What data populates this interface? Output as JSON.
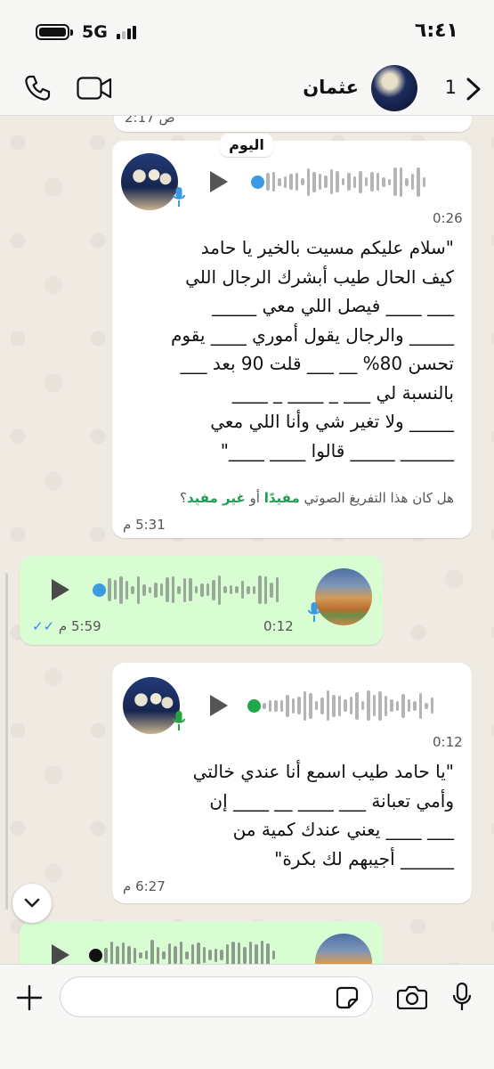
{
  "status_bar": {
    "time": "٦:٤١",
    "network": "5G"
  },
  "header": {
    "contact_name": "عثمان",
    "unread_count": "1"
  },
  "chat": {
    "previous_time": "2:17 ص",
    "date_chip": "اليوم",
    "messages": [
      {
        "direction": "incoming",
        "duration": "0:26",
        "transcript": "\"سلام عليكم مسيت بالخير يا حامد\nكيف الحال طيب أبشرك الرجال اللي\n___ ____ فيصل اللي معي _____\n_____ والرجال يقول أموري ____ يقوم\nتحسن 80% __ ___ قلت 90 بعد ___\nبالنسبة لي ___ _ ____ _ ____\n_____ ولا تغير شي وأنا اللي معي\n______ _____ قالوا ____ ____\"",
        "feedback_prefix": "هل كان هذا التفريغ الصوتي",
        "feedback_helpful": "مفيدًا",
        "feedback_or": "أو",
        "feedback_unhelpful": "غير مفيد",
        "feedback_suffix": "؟",
        "time": "5:31 م"
      },
      {
        "direction": "outgoing",
        "duration": "0:12",
        "time": "5:59 م",
        "read_status": "read"
      },
      {
        "direction": "incoming",
        "duration": "0:12",
        "transcript": "\"يا حامد طيب اسمع أنا عندي خالتي\nوأمي تعبانة ___ ____ __ ____ إن\n___ ____ يعني عندك كمية من\n______ أجيبهم لك بكرة\"",
        "time": "6:27 م"
      },
      {
        "direction": "outgoing",
        "state": "partially visible"
      }
    ]
  },
  "composer": {
    "placeholder": ""
  },
  "icons": {
    "call": "phone-icon",
    "video": "video-camera-icon",
    "back": "chevron-left-icon",
    "add": "plus-icon",
    "sticker": "sticker-icon",
    "camera": "camera-icon",
    "mic": "microphone-icon",
    "scroll_down": "chevron-down-icon"
  },
  "colors": {
    "outgoing_bubble": "#d9fdd3",
    "incoming_bubble": "#ffffff",
    "wallpaper": "#efeae2",
    "mic_blue": "#3b9ae1",
    "mic_green": "#25a244",
    "played_dot": "#3b9ae1",
    "unplayed_dot": "#1fa74a"
  }
}
